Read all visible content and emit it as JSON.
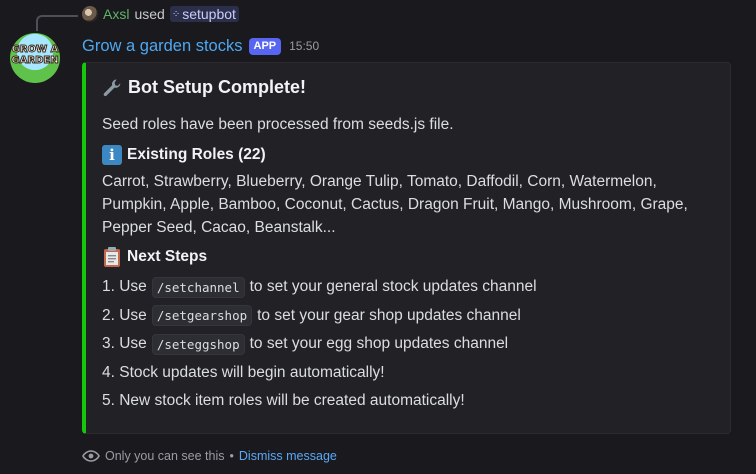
{
  "reply": {
    "user": "Axsl",
    "used": "used",
    "command": "setupbot"
  },
  "header": {
    "bot_name": "Grow a garden stocks",
    "app_tag": "APP",
    "timestamp": "15:50"
  },
  "avatar": {
    "text_line1": "GROW A",
    "text_line2": "GARDEN"
  },
  "embed": {
    "accent_color": "#16c60c",
    "title": "Bot Setup Complete!",
    "title_icon": "wrench-icon",
    "description": "Seed roles have been processed from seeds.js file.",
    "roles_section": {
      "icon": "info-icon",
      "title": "Existing Roles (22)",
      "text": "Carrot, Strawberry, Blueberry, Orange Tulip, Tomato, Daffodil, Corn, Watermelon, Pumpkin, Apple, Bamboo, Coconut, Cactus, Dragon Fruit, Mango, Mushroom, Grape, Pepper Seed, Cacao, Beanstalk..."
    },
    "steps_section": {
      "icon": "clipboard-icon",
      "title": "Next Steps",
      "steps": [
        {
          "pre": "1. Use",
          "code": "/setchannel",
          "post": "to set your general stock updates channel"
        },
        {
          "pre": "2. Use",
          "code": "/setgearshop",
          "post": "to set your gear shop updates channel"
        },
        {
          "pre": "3. Use",
          "code": "/seteggshop",
          "post": "to set your egg shop updates channel"
        },
        {
          "pre": "4. Stock updates will begin automatically!",
          "code": "",
          "post": ""
        },
        {
          "pre": "5. New stock item roles will be created automatically!",
          "code": "",
          "post": ""
        }
      ]
    }
  },
  "footer": {
    "only_you": "Only you can see this",
    "separator": "•",
    "dismiss": "Dismiss message"
  }
}
